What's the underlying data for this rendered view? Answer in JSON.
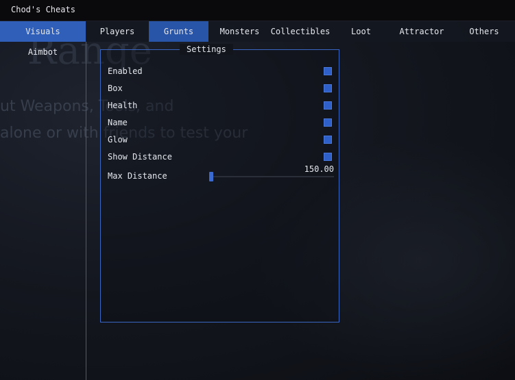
{
  "window": {
    "title": "Chod's Cheats"
  },
  "background": {
    "big_text": "Range",
    "line1": "ut Weapons, Tools, and",
    "line2": "alone or with friends to test your"
  },
  "tabs": [
    {
      "label": "Visuals",
      "active": true
    },
    {
      "label": "Players"
    },
    {
      "label": "Grunts",
      "selected": true
    },
    {
      "label": "Monsters"
    },
    {
      "label": "Collectibles"
    },
    {
      "label": "Loot"
    },
    {
      "label": "Attractor"
    },
    {
      "label": "Others"
    }
  ],
  "subtabs": [
    {
      "label": "Aimbot"
    }
  ],
  "settings": {
    "title": "Settings",
    "options": [
      {
        "label": "Enabled",
        "checked": true
      },
      {
        "label": "Box",
        "checked": true
      },
      {
        "label": "Health",
        "checked": true
      },
      {
        "label": "Name",
        "checked": true
      },
      {
        "label": "Glow",
        "checked": true
      },
      {
        "label": "Show Distance",
        "checked": true
      }
    ],
    "slider": {
      "label": "Max Distance",
      "value": "150.00",
      "fraction": 0.0
    }
  },
  "colors": {
    "accent": "#2f5fb8",
    "checkbox": "#2f5fc8",
    "border": "#3a66c4"
  }
}
